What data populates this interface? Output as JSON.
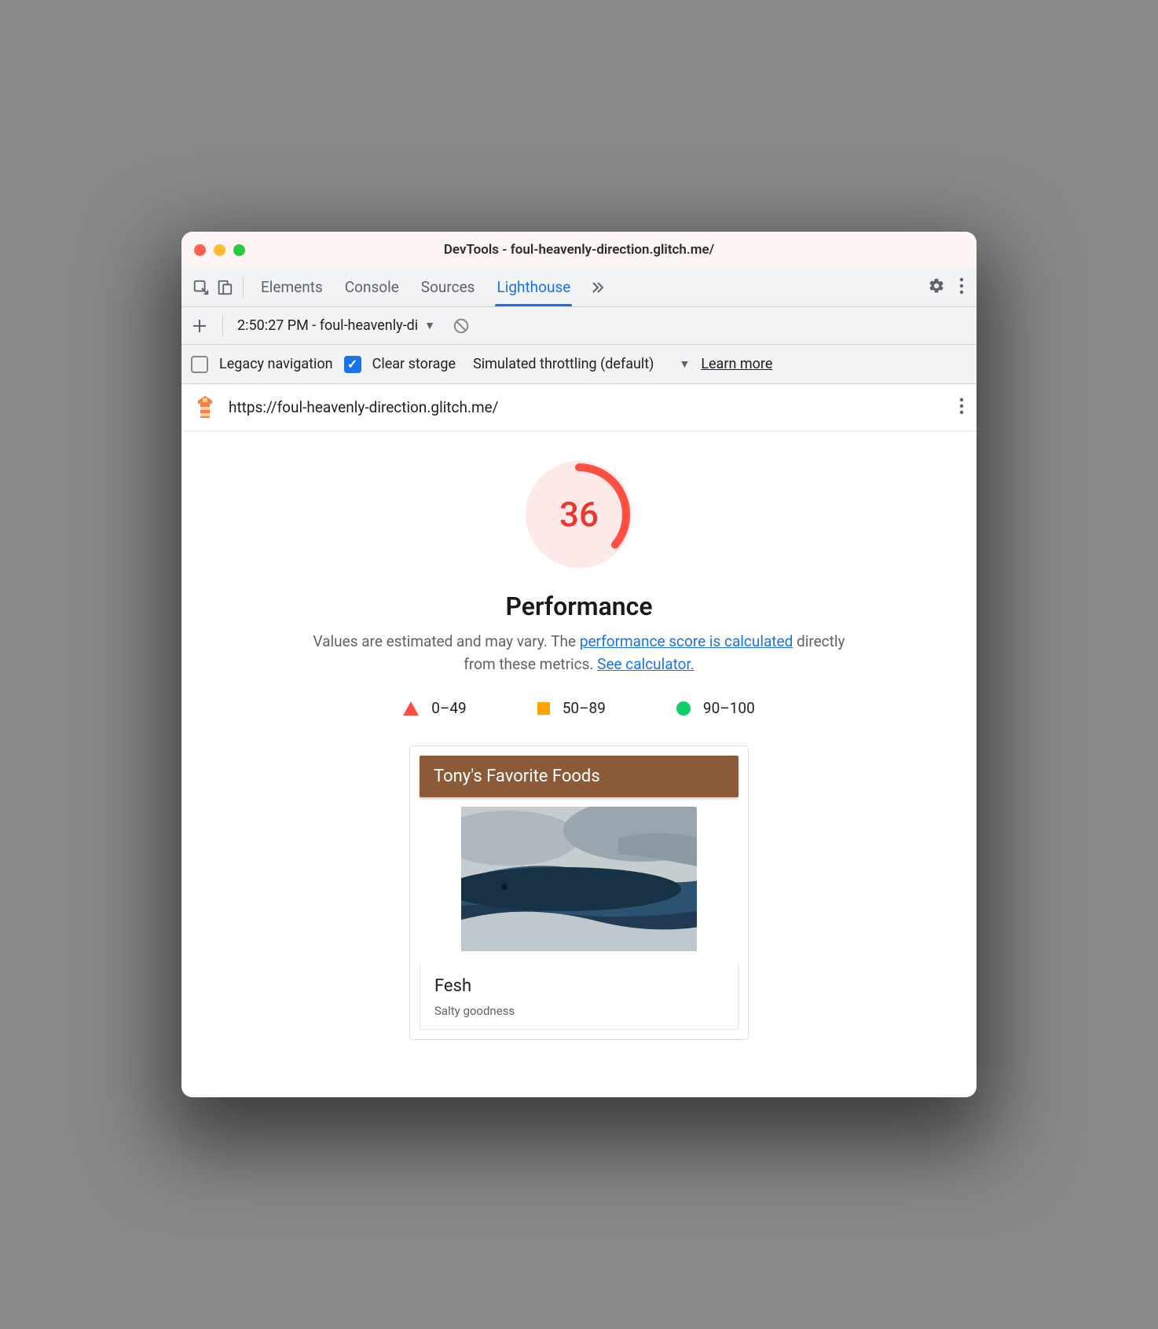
{
  "window": {
    "title": "DevTools - foul-heavenly-direction.glitch.me/"
  },
  "toolbar": {
    "tabs": [
      "Elements",
      "Console",
      "Sources",
      "Lighthouse"
    ],
    "active_tab": "Lighthouse"
  },
  "row2": {
    "report_label": "2:50:27 PM - foul-heavenly-di"
  },
  "row3": {
    "legacy_label": "Legacy navigation",
    "clear_label": "Clear storage",
    "throttling_label": "Simulated throttling (default)",
    "learn_more": "Learn more"
  },
  "urlrow": {
    "url": "https://foul-heavenly-direction.glitch.me/"
  },
  "report": {
    "score": "36",
    "score_color": "#e8392f",
    "heading": "Performance",
    "desc_pre": "Values are estimated and may vary. The ",
    "link1": "performance score is calculated",
    "desc_mid": " directly from these metrics. ",
    "link2": "See calculator.",
    "legend": {
      "fail": "0–49",
      "avg": "50–89",
      "pass": "90–100"
    }
  },
  "card": {
    "header": "Tony's Favorite Foods",
    "title": "Fesh",
    "subtitle": "Salty goodness"
  }
}
